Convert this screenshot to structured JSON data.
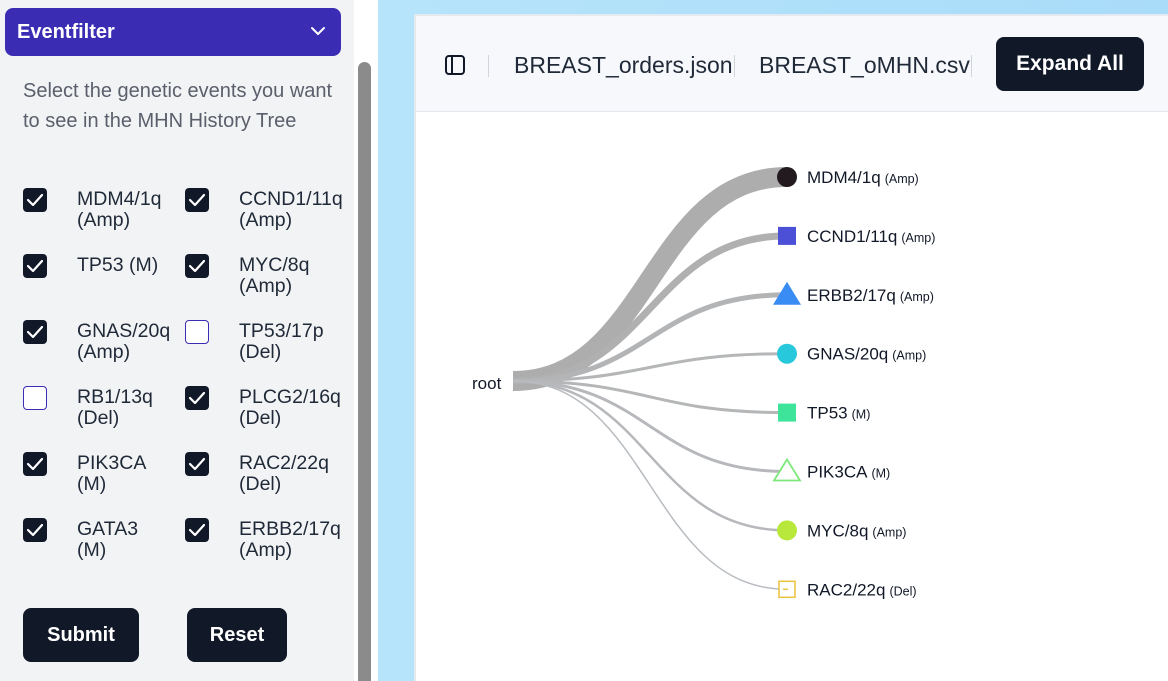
{
  "sidebar": {
    "header_title": "Eventfilter",
    "description": "Select the genetic events you want to see in the MHN History Tree",
    "events": [
      {
        "line1": "MDM4/1q",
        "line2": "(Amp)",
        "checked": true
      },
      {
        "line1": "CCND1/11q",
        "line2": "(Amp)",
        "checked": true
      },
      {
        "line1": "TP53 (M)",
        "line2": "",
        "checked": true
      },
      {
        "line1": "MYC/8q",
        "line2": "(Amp)",
        "checked": true
      },
      {
        "line1": "GNAS/20q",
        "line2": "(Amp)",
        "checked": true
      },
      {
        "line1": "TP53/17p",
        "line2": "(Del)",
        "checked": false
      },
      {
        "line1": "RB1/13q",
        "line2": "(Del)",
        "checked": false
      },
      {
        "line1": "PLCG2/16q",
        "line2": "(Del)",
        "checked": true
      },
      {
        "line1": "PIK3CA",
        "line2": "(M)",
        "checked": true
      },
      {
        "line1": "RAC2/22q",
        "line2": "(Del)",
        "checked": true
      },
      {
        "line1": "GATA3",
        "line2": "(M)",
        "checked": true
      },
      {
        "line1": "ERBB2/17q",
        "line2": "(Amp)",
        "checked": true
      }
    ],
    "submit_label": "Submit",
    "reset_label": "Reset"
  },
  "toolbar": {
    "file1": "BREAST_orders.json",
    "file2": "BREAST_oMHN.csv",
    "expand_label": "Expand All"
  },
  "tree": {
    "root_label": "root",
    "nodes": [
      {
        "name": "MDM4/1q",
        "suffix": "(Amp)",
        "shape": "circle",
        "color": "#231a1f",
        "weight": 20
      },
      {
        "name": "CCND1/11q",
        "suffix": "(Amp)",
        "shape": "square",
        "color": "#4b50d6",
        "weight": 7
      },
      {
        "name": "ERBB2/17q",
        "suffix": "(Amp)",
        "shape": "triangle",
        "color": "#3a8cf5",
        "weight": 5
      },
      {
        "name": "GNAS/20q",
        "suffix": "(Amp)",
        "shape": "circle",
        "color": "#28c8dc",
        "weight": 3
      },
      {
        "name": "TP53",
        "suffix": "(M)",
        "shape": "square",
        "color": "#3ee49a",
        "weight": 3
      },
      {
        "name": "PIK3CA",
        "suffix": "(M)",
        "shape": "triangle-outline",
        "color": "#7ee87a",
        "weight": 3
      },
      {
        "name": "MYC/8q",
        "suffix": "(Amp)",
        "shape": "circle",
        "color": "#b8e83c",
        "weight": 2.5
      },
      {
        "name": "RAC2/22q",
        "suffix": "(Del)",
        "shape": "square-outline",
        "color": "#e8c23c",
        "weight": 1.5
      }
    ]
  }
}
